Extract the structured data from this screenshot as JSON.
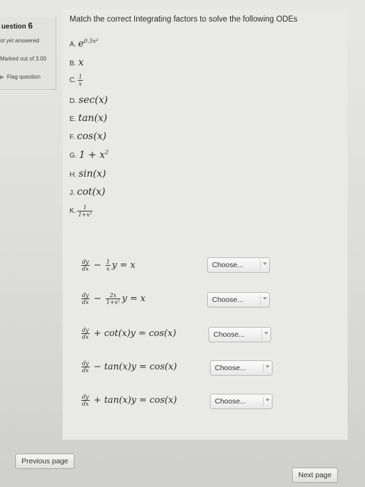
{
  "sidebar": {
    "question_word": "uestion",
    "question_number": "6",
    "status": "ot yet answered",
    "marks": "Marked out of 3.00",
    "flag_label": "Flag question"
  },
  "question": {
    "prompt": "Match the correct Integrating factors to solve the following ODEs",
    "options": [
      {
        "letter": "A.",
        "expr": "e",
        "sup": "0.5x²"
      },
      {
        "letter": "B.",
        "expr": "x"
      },
      {
        "letter": "C.",
        "num": "1",
        "den": "x"
      },
      {
        "letter": "D.",
        "expr": "sec(x)"
      },
      {
        "letter": "E.",
        "expr": "tan(x)"
      },
      {
        "letter": "F.",
        "expr": "cos(x)"
      },
      {
        "letter": "G.",
        "expr": "1 + x",
        "sup": "2"
      },
      {
        "letter": "H.",
        "expr": "sin(x)"
      },
      {
        "letter": "J.",
        "expr": "cot(x)"
      },
      {
        "letter": "K.",
        "num": "1",
        "den": "1+x²"
      }
    ],
    "equations": [
      {
        "dy": "dy",
        "dx": "dx",
        "coef_num": "1",
        "coef_den": "x",
        "op": "−",
        "tail": "y = x"
      },
      {
        "dy": "dy",
        "dx": "dx",
        "coef_num": "2x",
        "coef_den": "1+x²",
        "op": "−",
        "tail": "y = x"
      },
      {
        "dy": "dy",
        "dx": "dx",
        "op": "+",
        "tail": "cot(x)y = cos(x)"
      },
      {
        "dy": "dy",
        "dx": "dx",
        "op": "−",
        "tail": "tan(x)y = cos(x)"
      },
      {
        "dy": "dy",
        "dx": "dx",
        "op": "+",
        "tail": "tan(x)y = cos(x)"
      }
    ],
    "choose_label": "Choose..."
  },
  "nav": {
    "previous": "Previous page",
    "next": "Next page"
  }
}
